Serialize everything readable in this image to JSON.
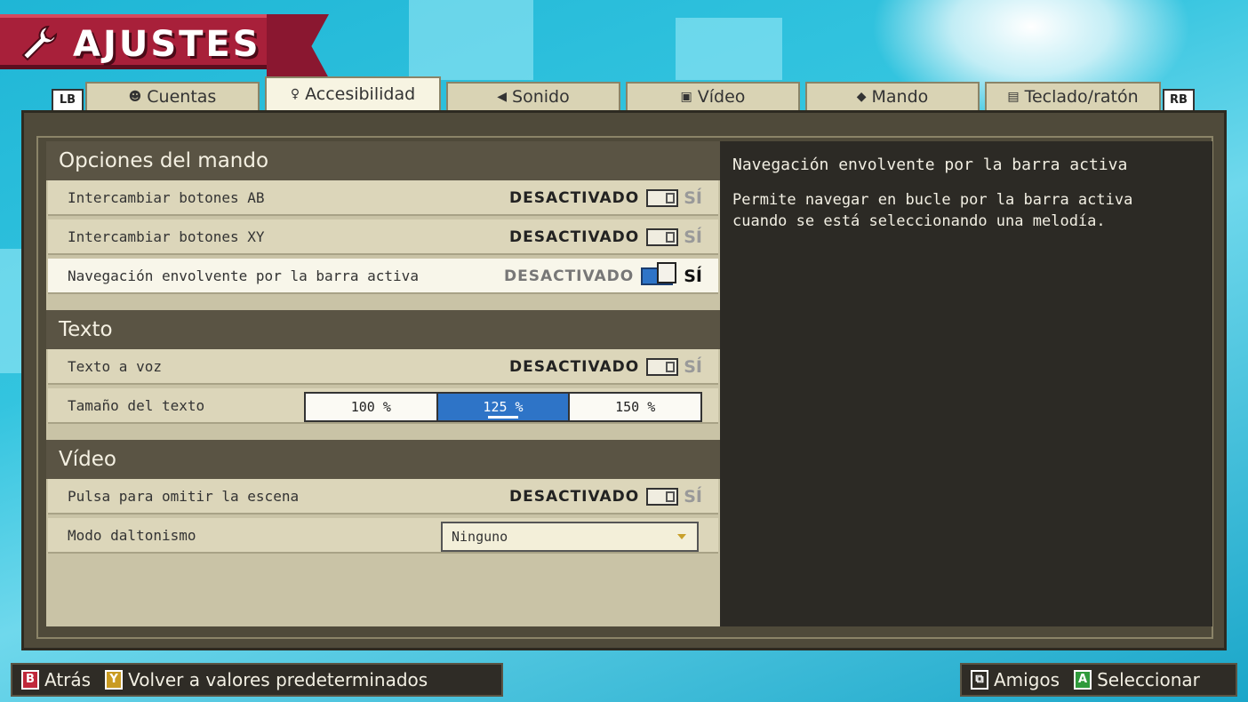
{
  "title": "AJUSTES",
  "tabs": {
    "lb": "LB",
    "rb": "RB",
    "items": [
      {
        "label": "Cuentas",
        "icon": "person-icon"
      },
      {
        "label": "Accesibilidad",
        "icon": "accessibility-icon"
      },
      {
        "label": "Sonido",
        "icon": "speaker-icon"
      },
      {
        "label": "Vídeo",
        "icon": "monitor-icon"
      },
      {
        "label": "Mando",
        "icon": "gamepad-icon"
      },
      {
        "label": "Teclado/ratón",
        "icon": "keyboard-icon"
      }
    ],
    "active_index": 1
  },
  "sections": {
    "controller": {
      "title": "Opciones del mando",
      "rows": [
        {
          "label": "Intercambiar botones AB",
          "off": "DESACTIVADO",
          "on": "SÍ"
        },
        {
          "label": "Intercambiar botones XY",
          "off": "DESACTIVADO",
          "on": "SÍ"
        },
        {
          "label": "Navegación envolvente por la barra activa",
          "off": "DESACTIVADO",
          "on": "SÍ"
        }
      ]
    },
    "text": {
      "title": "Texto",
      "tts": {
        "label": "Texto a voz",
        "off": "DESACTIVADO",
        "on": "SÍ"
      },
      "size": {
        "label": "Tamaño del texto",
        "options": [
          "100 %",
          "125 %",
          "150 %"
        ],
        "selected": "125 %"
      }
    },
    "video": {
      "title": "Vídeo",
      "skip": {
        "label": "Pulsa para omitir la escena",
        "off": "DESACTIVADO",
        "on": "SÍ"
      },
      "colorblind": {
        "label": "Modo daltonismo",
        "value": "Ninguno"
      }
    }
  },
  "description": {
    "title": "Navegación envolvente por la barra activa",
    "body": "Permite navegar en bucle por la barra activa cuando se está seleccionando una melodía."
  },
  "footer": {
    "left": [
      {
        "key": "B",
        "label": "Atrás",
        "color": "#c0283a"
      },
      {
        "key": "Y",
        "label": "Volver a valores predeterminados",
        "color": "#c99b22"
      }
    ],
    "right": [
      {
        "key": "⧉",
        "label": "Amigos",
        "icon": "friends-icon"
      },
      {
        "key": "A",
        "label": "Seleccionar",
        "color": "#2f9a3c"
      }
    ]
  }
}
